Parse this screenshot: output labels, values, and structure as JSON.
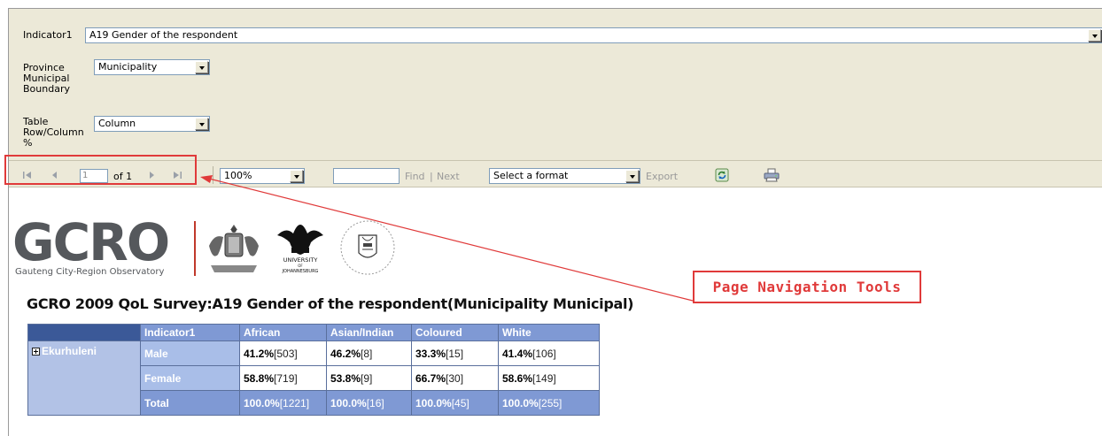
{
  "parameters": {
    "indicator": {
      "label": "Indicator1",
      "value": "A19 Gender of the respondent"
    },
    "boundary": {
      "label_lines": [
        "Province",
        "Municipal",
        "Boundary"
      ],
      "value": "Municipality"
    },
    "table_pct": {
      "label_lines": [
        "Table",
        "Row/Column",
        "%"
      ],
      "value": "Column"
    }
  },
  "toolbar": {
    "page_value": "1",
    "page_of": "of 1",
    "zoom": "100%",
    "find_label": "Find",
    "find_sep": "|",
    "next_label": "Next",
    "format_placeholder": "Select a format",
    "export_label": "Export"
  },
  "annotation": {
    "callout_text": "Page Navigation Tools"
  },
  "logos": {
    "gcro_word": "GCRO",
    "gcro_subtitle": "Gauteng City-Region Observatory",
    "uj_lines": [
      "UNIVERSITY",
      "OF",
      "JOHANNESBURG"
    ]
  },
  "report": {
    "title": "GCRO 2009 QoL Survey:A19 Gender of the respondent(Municipality Municipal)",
    "columns": [
      "Indicator1",
      "African",
      "Asian/Indian",
      "Coloured",
      "White"
    ],
    "group": "Ekurhuleni",
    "rows": [
      {
        "label": "Male",
        "cells": [
          [
            "41.2%",
            "[503]"
          ],
          [
            "46.2%",
            "[8]"
          ],
          [
            "33.3%",
            "[15]"
          ],
          [
            "41.4%",
            "[106]"
          ]
        ]
      },
      {
        "label": "Female",
        "cells": [
          [
            "58.8%",
            "[719]"
          ],
          [
            "53.8%",
            "[9]"
          ],
          [
            "66.7%",
            "[30]"
          ],
          [
            "58.6%",
            "[149]"
          ]
        ]
      },
      {
        "label": "Total",
        "cells": [
          [
            "100.0%",
            "[1221]"
          ],
          [
            "100.0%",
            "[16]"
          ],
          [
            "100.0%",
            "[45]"
          ],
          [
            "100.0%",
            "[255]"
          ]
        ]
      }
    ]
  },
  "colors": {
    "accent_red": "#e03a3a",
    "header_blue": "#7f99d4",
    "corner_blue": "#3b5998",
    "param_bg": "#ece9d8"
  }
}
